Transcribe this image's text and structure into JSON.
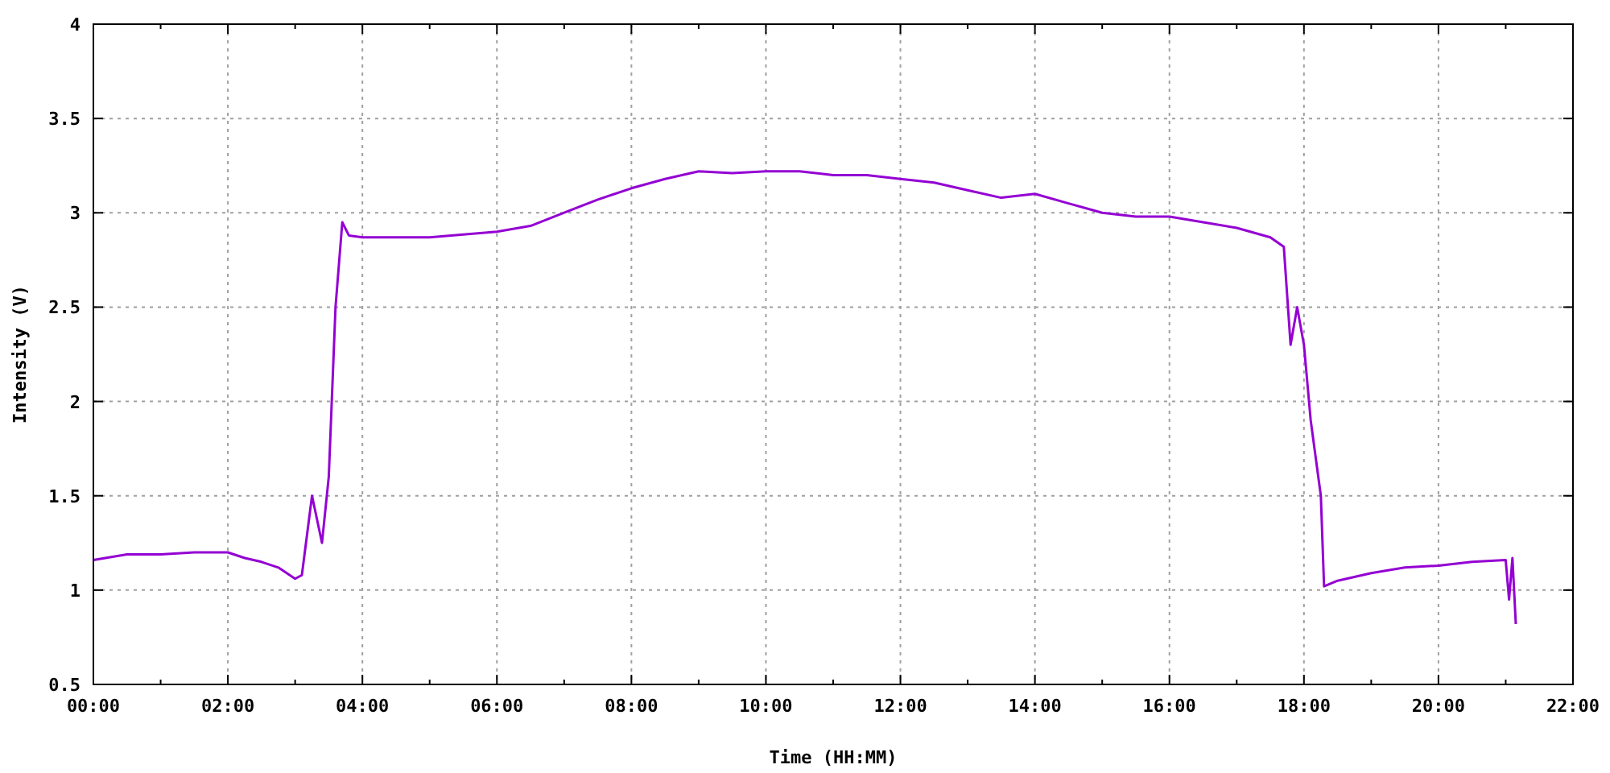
{
  "chart_data": {
    "type": "line",
    "xlabel": "Time (HH:MM)",
    "ylabel": "Intensity (V)",
    "x": [
      0,
      0.5,
      1,
      1.5,
      2,
      2.25,
      2.5,
      2.75,
      3,
      3.1,
      3.25,
      3.4,
      3.5,
      3.6,
      3.7,
      3.8,
      4,
      5,
      6,
      6.5,
      7,
      7.5,
      8,
      8.5,
      9,
      9.5,
      10,
      10.5,
      11,
      11.5,
      12,
      12.5,
      13,
      13.5,
      14,
      14.5,
      15,
      15.5,
      16,
      16.5,
      17,
      17.5,
      17.7,
      17.8,
      17.9,
      18,
      18.1,
      18.25,
      18.3,
      18.5,
      19,
      19.5,
      20,
      20.5,
      21,
      21.05,
      21.1,
      21.15
    ],
    "series": [
      {
        "color": "#9400d3",
        "values": [
          1.16,
          1.19,
          1.19,
          1.2,
          1.2,
          1.17,
          1.15,
          1.12,
          1.06,
          1.08,
          1.5,
          1.25,
          1.6,
          2.5,
          2.95,
          2.88,
          2.87,
          2.87,
          2.9,
          2.93,
          3.0,
          3.07,
          3.13,
          3.18,
          3.22,
          3.21,
          3.22,
          3.22,
          3.2,
          3.2,
          3.18,
          3.16,
          3.12,
          3.08,
          3.1,
          3.05,
          3.0,
          2.98,
          2.98,
          2.95,
          2.92,
          2.87,
          2.82,
          2.3,
          2.5,
          2.3,
          1.9,
          1.5,
          1.02,
          1.05,
          1.09,
          1.12,
          1.13,
          1.15,
          1.16,
          0.95,
          1.17,
          0.82
        ]
      }
    ],
    "grid": true,
    "xlim": [
      0,
      22
    ],
    "ylim": [
      0.5,
      4
    ],
    "xticks": [
      {
        "value": 0,
        "label": "00:00"
      },
      {
        "value": 2,
        "label": "02:00"
      },
      {
        "value": 4,
        "label": "04:00"
      },
      {
        "value": 6,
        "label": "06:00"
      },
      {
        "value": 8,
        "label": "08:00"
      },
      {
        "value": 10,
        "label": "10:00"
      },
      {
        "value": 12,
        "label": "12:00"
      },
      {
        "value": 14,
        "label": "14:00"
      },
      {
        "value": 16,
        "label": "16:00"
      },
      {
        "value": 18,
        "label": "18:00"
      },
      {
        "value": 20,
        "label": "20:00"
      },
      {
        "value": 22,
        "label": "22:00"
      }
    ],
    "yticks": [
      {
        "value": 0.5,
        "label": "0.5"
      },
      {
        "value": 1,
        "label": "1"
      },
      {
        "value": 1.5,
        "label": "1.5"
      },
      {
        "value": 2,
        "label": "2"
      },
      {
        "value": 2.5,
        "label": "2.5"
      },
      {
        "value": 3,
        "label": "3"
      },
      {
        "value": 3.5,
        "label": "3.5"
      },
      {
        "value": 4,
        "label": "4"
      }
    ]
  }
}
